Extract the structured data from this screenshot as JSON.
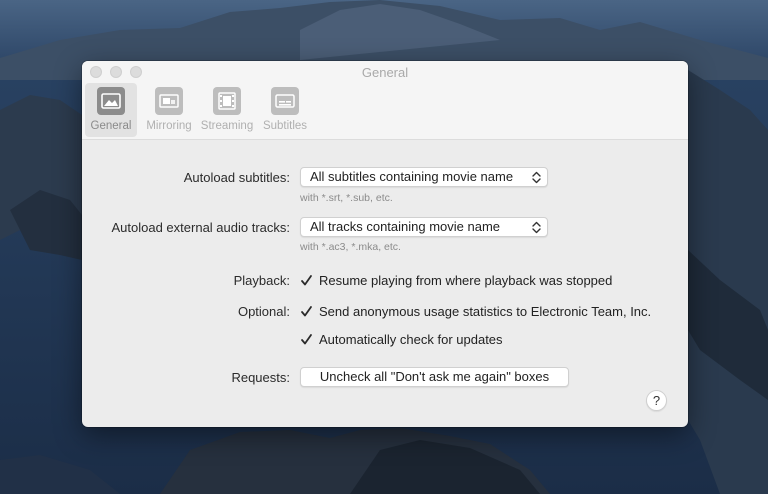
{
  "window": {
    "title": "General"
  },
  "toolbar": {
    "tabs": [
      {
        "label": "General",
        "icon": "general-icon",
        "active": true
      },
      {
        "label": "Mirroring",
        "icon": "mirroring-icon",
        "active": false
      },
      {
        "label": "Streaming",
        "icon": "film-icon",
        "active": false
      },
      {
        "label": "Subtitles",
        "icon": "subtitles-icon",
        "active": false
      }
    ]
  },
  "settings": {
    "autoload_subtitles": {
      "label": "Autoload subtitles:",
      "value": "All subtitles containing movie name",
      "hint": "with *.srt, *.sub, etc."
    },
    "autoload_audio": {
      "label": "Autoload external audio tracks:",
      "value": "All tracks containing movie name",
      "hint": "with *.ac3, *.mka, etc."
    },
    "playback": {
      "label": "Playback:",
      "option": "Resume playing from where playback was stopped",
      "checked": true
    },
    "optional": {
      "label": "Optional:",
      "options": [
        {
          "label": "Send anonymous usage statistics to Electronic Team, Inc.",
          "checked": true
        },
        {
          "label": "Automatically check for updates",
          "checked": true
        }
      ]
    },
    "requests": {
      "label": "Requests:",
      "button": "Uncheck all \"Don't ask me again\" boxes"
    },
    "help_label": "?"
  },
  "colors": {
    "window_bg": "#ececec",
    "titlebar_bg": "#f5f5f5",
    "text": "#222222",
    "hint_text": "#8b8b8b"
  }
}
